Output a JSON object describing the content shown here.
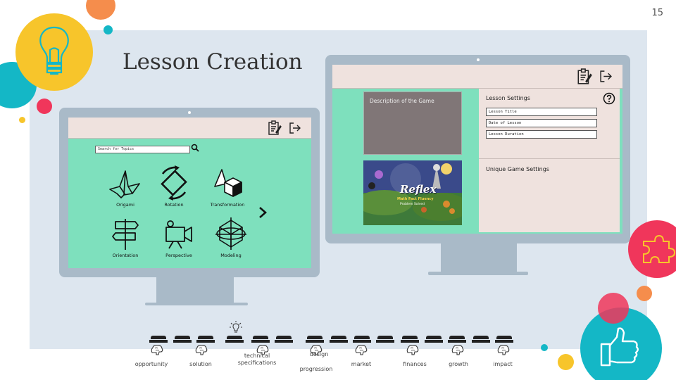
{
  "slide": {
    "number": "15",
    "title": "Lesson Creation"
  },
  "colors": {
    "panel": "#dde6ef",
    "screen_green": "#7ee0bd",
    "toolbar": "#efe2de",
    "monitor": "#a9bac8",
    "yellow_circle": "#f7c52b",
    "teal_circle": "#14b7c6",
    "pink_circle": "#f0365b",
    "orange_circle": "#f58d4c"
  },
  "left_screen": {
    "search_placeholder": "Search for Topics",
    "topics": [
      {
        "label": "Origami",
        "icon": "origami-crane-icon"
      },
      {
        "label": "Rotation",
        "icon": "rotation-icon"
      },
      {
        "label": "Transformation",
        "icon": "transformation-shapes-icon"
      },
      {
        "label": "Orientation",
        "icon": "signpost-icon"
      },
      {
        "label": "Perspective",
        "icon": "video-camera-icon"
      },
      {
        "label": "Modeling",
        "icon": "3d-model-icon"
      }
    ]
  },
  "right_screen": {
    "description_label": "Description of the Game",
    "game_image": {
      "logo": "Reflex",
      "subtitle": "Math Fact Fluency",
      "tagline": "Problem Solved"
    },
    "lesson_settings_header": "Lesson Settings",
    "fields": [
      "Lesson Title",
      "Date of Lesson",
      "Lesson Duration"
    ],
    "unique_settings_header": "Unique Game Settings"
  },
  "progress": {
    "steps": [
      {
        "label": "opportunity"
      },
      {
        "label": "solution"
      },
      {
        "label": "technical specifications"
      },
      {
        "label": "design progression"
      },
      {
        "label": "market"
      },
      {
        "label": "finances"
      },
      {
        "label": "growth"
      },
      {
        "label": "impact"
      }
    ],
    "labels": {
      "opportunity": "opportunity",
      "solution": "solution",
      "tech_line1": "technical",
      "tech_line2": "specifications",
      "design_line1": "design",
      "design_line2": "progression",
      "market": "market",
      "finances": "finances",
      "growth": "growth",
      "impact": "impact"
    }
  }
}
